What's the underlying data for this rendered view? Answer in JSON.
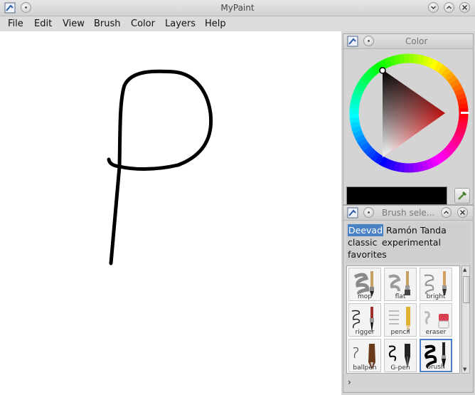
{
  "window": {
    "title": "MyPaint"
  },
  "menu": [
    "File",
    "Edit",
    "View",
    "Brush",
    "Color",
    "Layers",
    "Help"
  ],
  "color_panel": {
    "title": "Color",
    "current_color": "#000000",
    "accent": "#4a80c4"
  },
  "brush_panel": {
    "title": "Brush sele...",
    "groups": [
      {
        "label": "Deevad",
        "selected": true
      },
      {
        "label": "Ramón",
        "selected": false
      },
      {
        "label": "Tanda",
        "selected": false
      },
      {
        "label": "classic",
        "selected": false
      },
      {
        "label": "experimental",
        "selected": false
      },
      {
        "label": "favorites",
        "selected": false
      }
    ],
    "brushes": [
      {
        "label": "mop",
        "icon": "mop-brush-icon"
      },
      {
        "label": "flat",
        "icon": "flat-brush-icon"
      },
      {
        "label": "bright",
        "icon": "bright-brush-icon"
      },
      {
        "label": "rigger",
        "icon": "rigger-brush-icon"
      },
      {
        "label": "pencil",
        "icon": "pencil-brush-icon"
      },
      {
        "label": "eraser",
        "icon": "eraser-brush-icon"
      },
      {
        "label": "ballpen",
        "icon": "ballpen-brush-icon"
      },
      {
        "label": "G-pen",
        "icon": "g-pen-brush-icon"
      },
      {
        "label": "brush",
        "icon": "ink-brush-icon",
        "selected": true
      }
    ],
    "expander": "›"
  }
}
